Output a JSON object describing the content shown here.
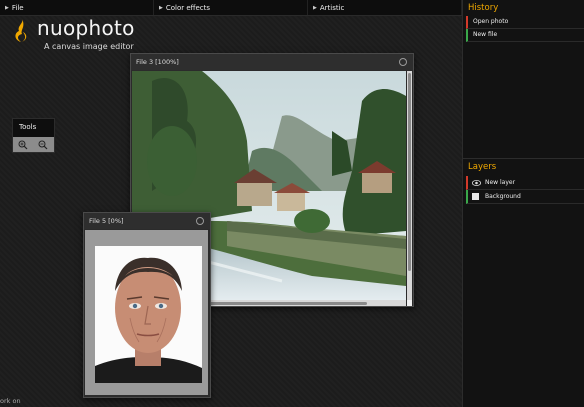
{
  "menubar": {
    "items": [
      "File",
      "Color effects",
      "Artistic"
    ]
  },
  "logo": {
    "name": "nuophoto",
    "tagline": "A canvas image editor",
    "accent": "#f0a800"
  },
  "tools": {
    "title": "Tools",
    "buttons": [
      "zoom-in-icon",
      "zoom-out-icon"
    ]
  },
  "windows": [
    {
      "title": "File 3 [100%]"
    },
    {
      "title": "File 5 [0%]"
    }
  ],
  "history": {
    "title": "History",
    "items": [
      "Open photo",
      "New file"
    ]
  },
  "layers": {
    "title": "Layers",
    "items": [
      "New layer",
      "Background"
    ]
  },
  "footer": {
    "text": "ork on"
  }
}
